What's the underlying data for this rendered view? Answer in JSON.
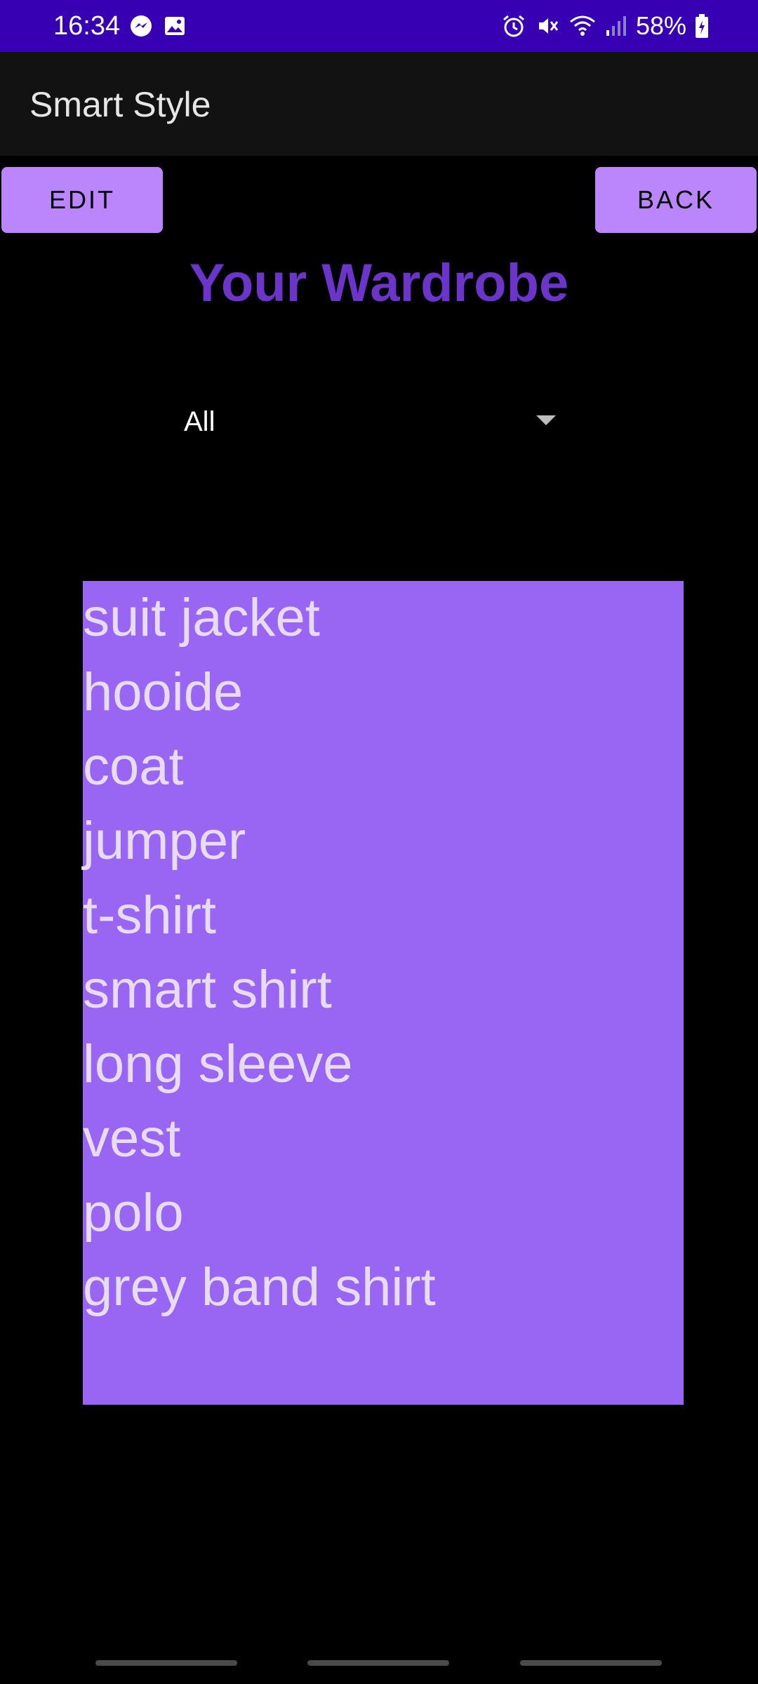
{
  "status_bar": {
    "time": "16:34",
    "battery": "58%",
    "left_icons": [
      "messenger-icon",
      "image-icon"
    ],
    "right_icons": [
      "alarm-icon",
      "mute-icon",
      "wifi-icon",
      "signal-icon",
      "battery-icon"
    ],
    "background": "#3700b3"
  },
  "app_bar": {
    "title": "Smart Style"
  },
  "buttons": {
    "edit": "EDIT",
    "back": "BACK",
    "color": "#bb86fc"
  },
  "page": {
    "title": "Your Wardrobe",
    "title_color": "#6a35c8"
  },
  "filter": {
    "selected": "All"
  },
  "wardrobe": {
    "items": [
      "suit jacket",
      "hooide",
      "coat",
      "jumper",
      "t-shirt",
      "smart shirt",
      "long sleeve",
      "vest",
      "polo",
      "grey band shirt"
    ],
    "background": "#9966f3"
  }
}
